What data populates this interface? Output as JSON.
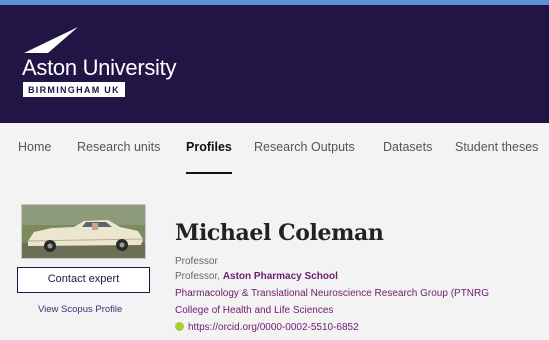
{
  "header": {
    "university_name": "Aston University",
    "university_location": "BIRMINGHAM UK",
    "background_color": "#201545"
  },
  "nav": {
    "items": [
      "Home",
      "Research units",
      "Profiles",
      "Research Outputs",
      "Datasets",
      "Student theses"
    ],
    "active_item": "Profiles"
  },
  "sidebar": {
    "contact_button_label": "Contact expert",
    "scopus_link_label": "View Scopus Profile"
  },
  "profile": {
    "name": "Michael Coleman",
    "title": "Professor",
    "position_prefix": "Professor,",
    "school": "Aston Pharmacy School",
    "group": "Pharmacology & Translational Neuroscience Research Group (PTNRG",
    "college": "College of Health and Life Sciences",
    "orcid_url": "https://orcid.org/0000-0002-5510-6852",
    "orcid_icon": "orcid-icon"
  },
  "colors": {
    "accent_purple": "#6d1c6e",
    "navy": "#201545",
    "orcid_green": "#a6ce39"
  }
}
